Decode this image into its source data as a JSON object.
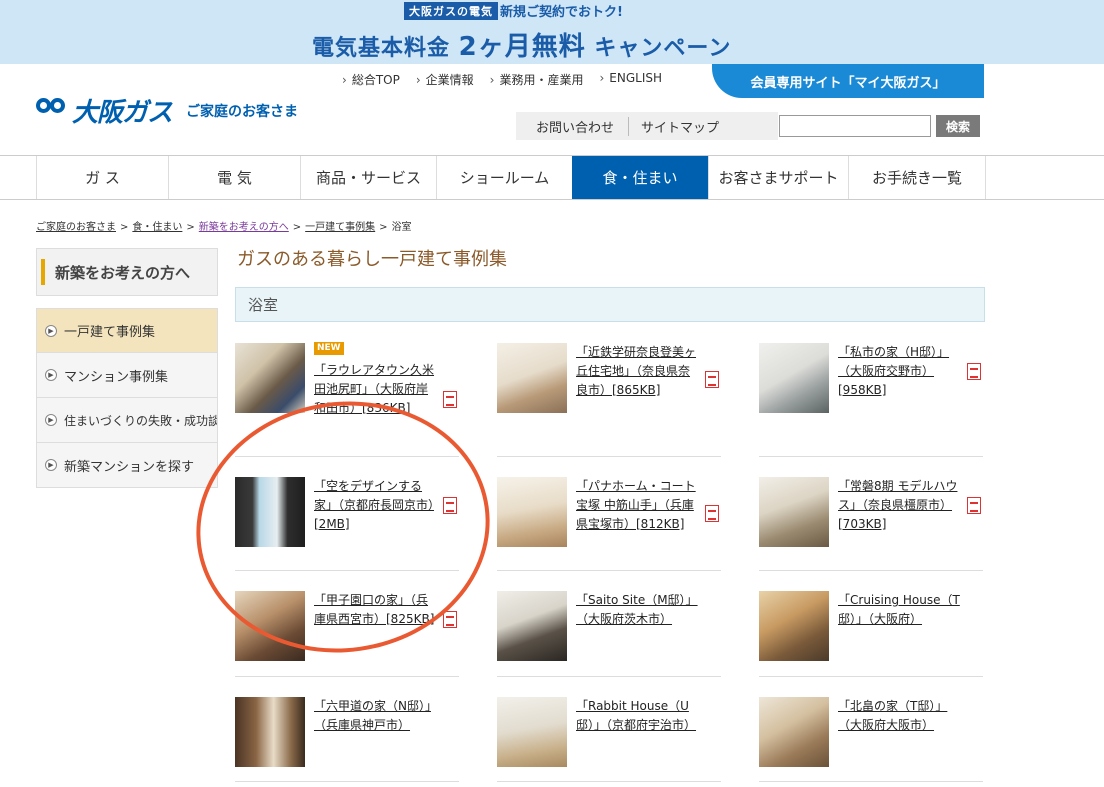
{
  "banner": {
    "tag": "大阪ガスの電気",
    "sub": "新規ご契約でおトク!",
    "main_prefix": "電気基本料金 ",
    "main_big": "2ヶ月無料",
    "main_suffix": " キャンペーン"
  },
  "header": {
    "logo_name": "大阪ガス",
    "logo_sub": "ご家庭のお客さま",
    "topnav": [
      "総合TOP",
      "企業情報",
      "業務用・産業用",
      "ENGLISH"
    ],
    "member_button": "会員専用サイト「マイ大阪ガス」",
    "util_links": [
      "お問い合わせ",
      "サイトマップ"
    ],
    "search_button": "検索"
  },
  "gnav": [
    "ガ ス",
    "電 気",
    "商品・サービス",
    "ショールーム",
    "食・住まい",
    "お客さまサポート",
    "お手続き一覧"
  ],
  "breadcrumb": [
    "ご家庭のお客さま",
    "食・住まい",
    "新築をお考えの方へ",
    "一戸建て事例集",
    "浴室"
  ],
  "sidebar": {
    "heading": "新築をお考えの方へ",
    "items": [
      "一戸建て事例集",
      "マンション事例集",
      "住まいづくりの失敗・成功談",
      "新築マンションを探す"
    ]
  },
  "content": {
    "title": "ガスのある暮らし一戸建て事例集",
    "section": "浴室",
    "new_badge": "NEW",
    "cards": [
      {
        "text": "「ラウレアタウン久米田池尻町」（大阪府岸和田市）[836KB]"
      },
      {
        "text": "「近鉄学研奈良登美ヶ丘住宅地」（奈良県奈良市）[865KB]"
      },
      {
        "text": "「私市の家（H邸）」（大阪府交野市）[958KB]"
      },
      {
        "text": "「空をデザインする家」（京都府長岡京市）[2MB]"
      },
      {
        "text": "「パナホーム・コート宝塚 中筋山手」（兵庫県宝塚市）[812KB]"
      },
      {
        "text": "「常磐8期 モデルハウス」（奈良県橿原市）[703KB]"
      },
      {
        "text": "「甲子園口の家」（兵庫県西宮市）[825KB]"
      },
      {
        "text": "「Saito Site（M邸）」（大阪府茨木市）"
      },
      {
        "text": "「Cruising House（T邸）」（大阪府）"
      },
      {
        "text": "「六甲道の家（N邸）」（兵庫県神戸市）"
      },
      {
        "text": "「Rabbit House（U邸）」（京都府宇治市）"
      },
      {
        "text": "「北畠の家（T邸）」（大阪府大阪市）"
      }
    ]
  },
  "colors": {
    "brand": "#0060b0",
    "member": "#1a8ad6",
    "annotation": "#ea5a32"
  }
}
